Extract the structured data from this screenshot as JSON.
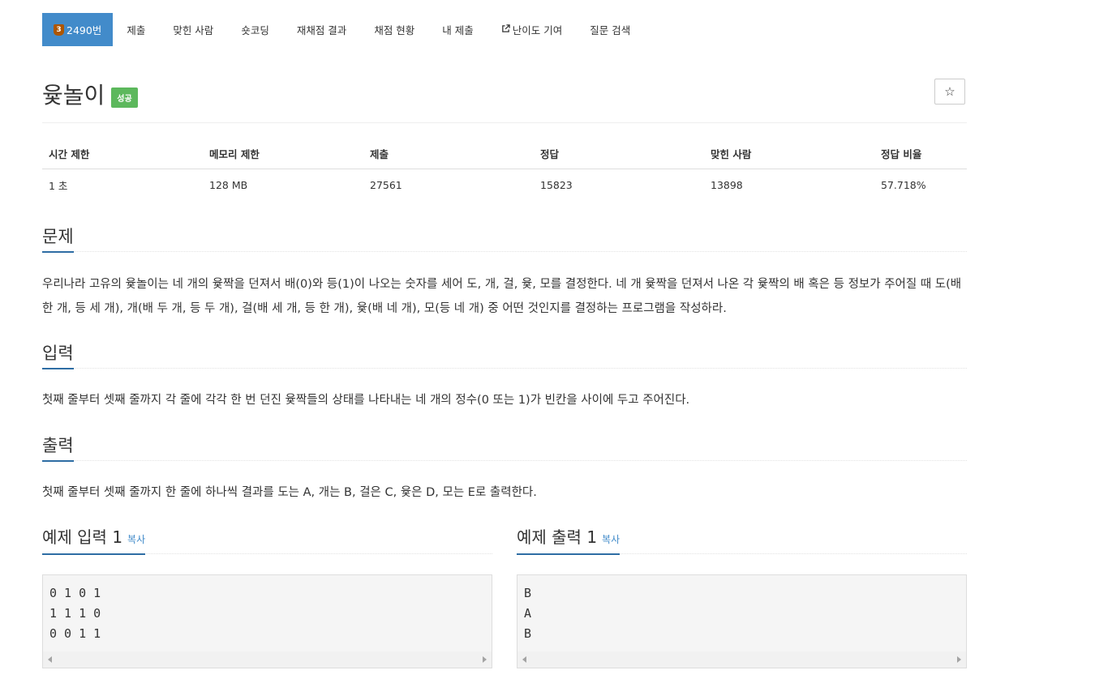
{
  "tabs": {
    "problem_tier": "3",
    "problem_number": "2490번",
    "items": [
      "제출",
      "맞힌 사람",
      "숏코딩",
      "재채점 결과",
      "채점 현황",
      "내 제출",
      "난이도 기여",
      "질문 검색"
    ]
  },
  "title": {
    "text": "윷놀이",
    "badge": "성공",
    "star": "☆"
  },
  "stats": {
    "headers": [
      "시간 제한",
      "메모리 제한",
      "제출",
      "정답",
      "맞힌 사람",
      "정답 비율"
    ],
    "values": [
      "1 초",
      "128 MB",
      "27561",
      "15823",
      "13898",
      "57.718%"
    ]
  },
  "sections": {
    "problem": {
      "heading": "문제",
      "text": "우리나라 고유의 윷놀이는 네 개의 윷짝을 던져서 배(0)와 등(1)이 나오는 숫자를 세어 도, 개, 걸, 윷, 모를 결정한다. 네 개 윷짝을 던져서 나온 각 윷짝의 배 혹은 등 정보가 주어질 때 도(배 한 개, 등 세 개), 개(배 두 개, 등 두 개), 걸(배 세 개, 등 한 개), 윷(배 네 개), 모(등 네 개) 중 어떤 것인지를 결정하는 프로그램을 작성하라."
    },
    "input": {
      "heading": "입력",
      "text": "첫째 줄부터 셋째 줄까지 각 줄에 각각 한 번 던진 윷짝들의 상태를 나타내는 네 개의 정수(0 또는 1)가 빈칸을 사이에 두고 주어진다."
    },
    "output": {
      "heading": "출력",
      "text": "첫째 줄부터 셋째 줄까지 한 줄에 하나씩 결과를 도는 A, 개는 B, 걸은 C, 윷은 D, 모는 E로 출력한다."
    }
  },
  "samples": {
    "input": {
      "heading": "예제 입력 1",
      "copy": "복사",
      "content": "0 1 0 1\n1 1 1 0\n0 0 1 1"
    },
    "output": {
      "heading": "예제 출력 1",
      "copy": "복사",
      "content": "B\nA\nB"
    }
  },
  "colors": {
    "active_tab": "#428bca",
    "success_badge": "#5cb85c",
    "section_underline": "#2e6da4",
    "tier_bronze": "#ad5600"
  }
}
